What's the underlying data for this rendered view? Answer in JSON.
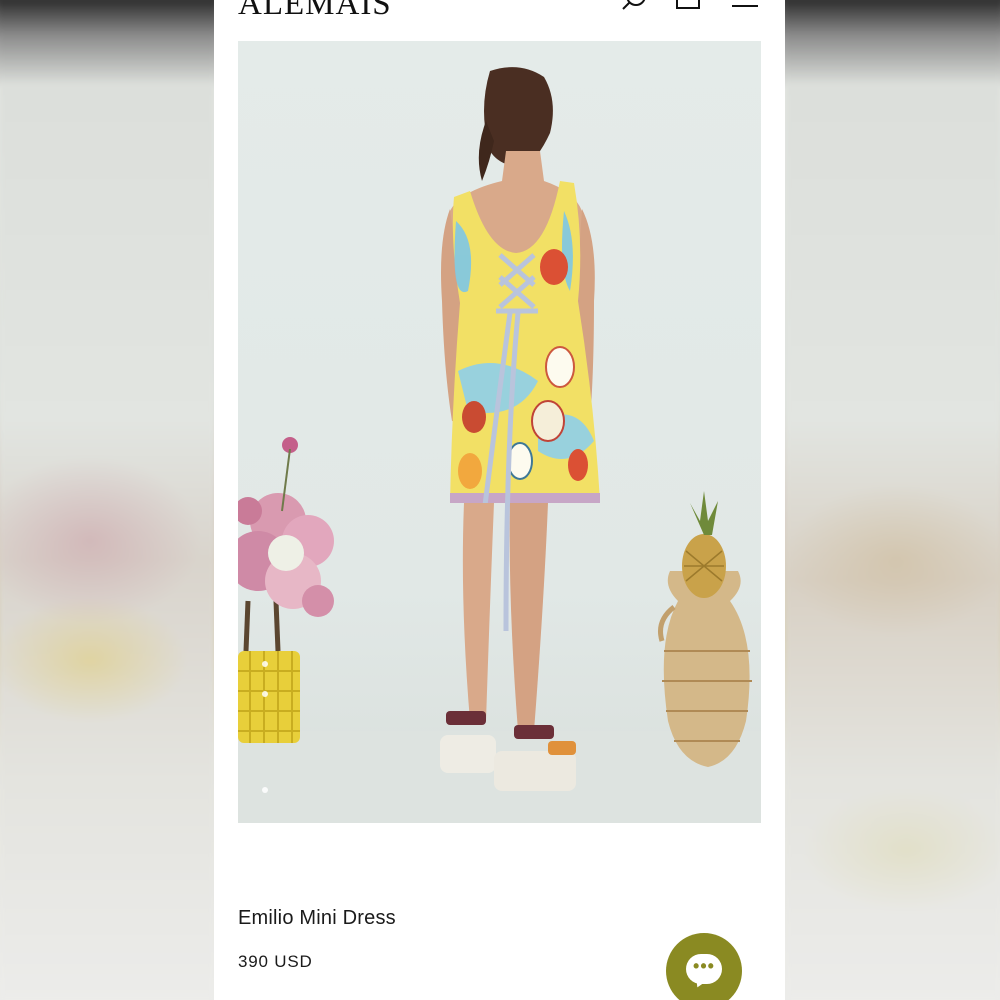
{
  "brand": {
    "logo_text": "ALEMAIS"
  },
  "header": {
    "icons": [
      "search-icon",
      "bag-icon",
      "menu-icon"
    ]
  },
  "product": {
    "name": "Emilio Mini Dress",
    "price": "390 USD",
    "image_alt": "Model wearing printed lace-up back mini dress"
  },
  "gallery": {
    "slide_count": 3,
    "active_slide": 1
  },
  "chat": {
    "icon": "chat-icon",
    "glyph": "•••"
  },
  "colors": {
    "chat_button": "#8a8a22",
    "background": "#ffffff",
    "text": "#1a1a1a"
  }
}
